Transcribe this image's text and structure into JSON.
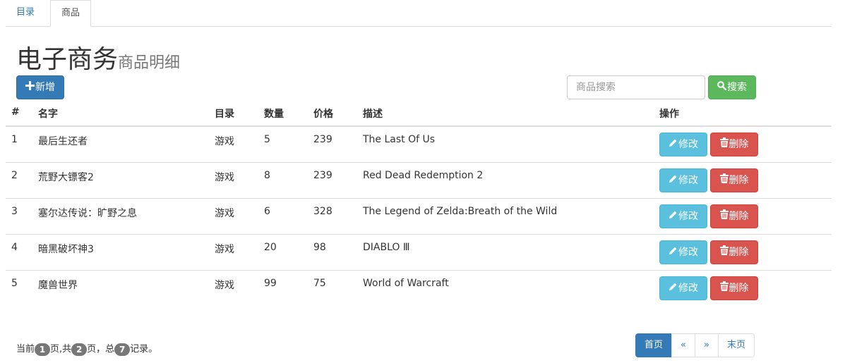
{
  "tabs": [
    {
      "label": "目录",
      "active": false
    },
    {
      "label": "商品",
      "active": true
    }
  ],
  "header": {
    "title": "电子商务",
    "subtitle": "商品明细"
  },
  "toolbar": {
    "add_label": "新增",
    "search_placeholder": "商品搜索",
    "search_value": "",
    "search_label": "搜索"
  },
  "table": {
    "columns": [
      "#",
      "名字",
      "目录",
      "数量",
      "价格",
      "描述",
      "操作"
    ],
    "rows": [
      {
        "id": "1",
        "name": "最后生还者",
        "category": "游戏",
        "qty": "5",
        "price": "239",
        "desc": "The Last Of Us"
      },
      {
        "id": "2",
        "name": "荒野大镖客2",
        "category": "游戏",
        "qty": "8",
        "price": "239",
        "desc": "Red Dead Redemption 2"
      },
      {
        "id": "3",
        "name": "塞尔达传说：旷野之息",
        "category": "游戏",
        "qty": "6",
        "price": "328",
        "desc": "The Legend of Zelda:Breath of the Wild"
      },
      {
        "id": "4",
        "name": "暗黑破坏神3",
        "category": "游戏",
        "qty": "20",
        "price": "98",
        "desc": "DIABLO Ⅲ"
      },
      {
        "id": "5",
        "name": "魔兽世界",
        "category": "游戏",
        "qty": "99",
        "price": "75",
        "desc": "World of Warcraft"
      }
    ],
    "edit_label": "修改",
    "delete_label": "删除"
  },
  "pager": {
    "prefix": "当前",
    "current_page": "1",
    "mid1": "页,共",
    "total_pages": "2",
    "mid2": "页，总",
    "total_records": "7",
    "suffix": "记录。",
    "first": "首页",
    "prev": "«",
    "next": "»",
    "last": "末页"
  },
  "colors": {
    "primary": "#337ab7",
    "success": "#5cb85c",
    "info": "#5bc0de",
    "danger": "#d9534f",
    "badge": "#777777"
  },
  "icons": {
    "add": "plus-icon",
    "search": "search-icon",
    "edit": "pencil-icon",
    "delete": "trash-icon"
  }
}
